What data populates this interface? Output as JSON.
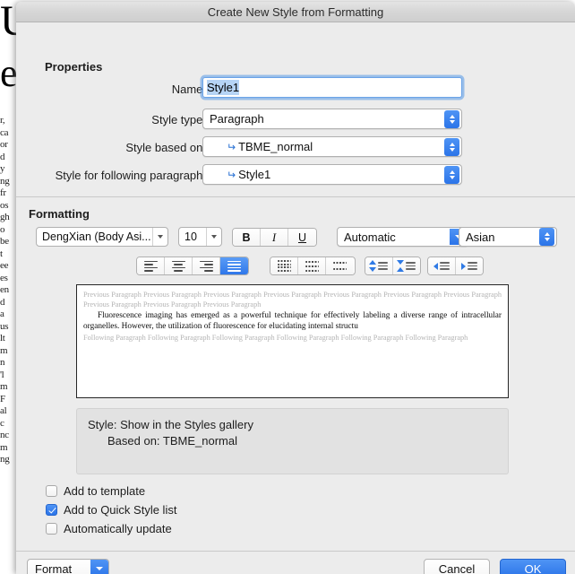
{
  "background_document": {
    "fragment_lines": [
      "r,",
      "ca",
      "or",
      "d",
      "y",
      "ng",
      "fr",
      "os",
      "gh",
      "o",
      "be",
      "t",
      "ee",
      "es",
      "en",
      "d",
      "a",
      "us",
      "lt",
      "m",
      "n",
      "'l",
      "m",
      "F",
      "al",
      "c",
      "nc",
      "m",
      "ng"
    ]
  },
  "dialog": {
    "title": "Create New Style from Formatting",
    "properties": {
      "heading": "Properties",
      "name_label": "Name:",
      "name_value": "Style1",
      "style_type_label": "Style type:",
      "style_type_value": "Paragraph",
      "style_based_on_label": "Style based on:",
      "style_based_on_value": "TBME_normal",
      "style_following_label": "Style for following paragraph:",
      "style_following_value": "Style1",
      "pilcrow_glyph": "↵"
    },
    "formatting": {
      "heading": "Formatting",
      "font_family": "DengXian (Body Asi...",
      "font_size": "10",
      "bold_label": "B",
      "italic_label": "I",
      "underline_label": "U",
      "color_value": "Automatic",
      "script_value": "Asian",
      "align_buttons": [
        "align-left",
        "align-center",
        "align-right",
        "align-justify"
      ],
      "align_selected": 3,
      "linespacing_buttons": [
        "line-spacing-single",
        "line-spacing-1-5",
        "line-spacing-double"
      ],
      "linespacing_selected": 0,
      "paraspacing_buttons": [
        "decrease-paragraph-spacing",
        "increase-paragraph-spacing"
      ],
      "indent_buttons": [
        "decrease-indent",
        "increase-indent"
      ]
    },
    "preview": {
      "previous_paragraph": "Previous Paragraph Previous Paragraph Previous Paragraph Previous Paragraph Previous Paragraph Previous Paragraph Previous Paragraph Previous Paragraph Previous Paragraph Previous Paragraph",
      "sample_text": "Fluorescence imaging has emerged as a powerful technique for effectively labeling a diverse range of intracellular organelles. However, the utilization of fluorescence for elucidating internal structu",
      "following_paragraph": "Following Paragraph Following Paragraph Following Paragraph Following Paragraph Following Paragraph Following Paragraph"
    },
    "description": {
      "line1": "Style: Show in the Styles gallery",
      "line2": "Based on: TBME_normal"
    },
    "checkboxes": [
      {
        "label": "Add to template",
        "checked": false
      },
      {
        "label": "Add to Quick Style list",
        "checked": true
      },
      {
        "label": "Automatically update",
        "checked": false
      }
    ],
    "footer": {
      "format_label": "Format",
      "cancel_label": "Cancel",
      "ok_label": "OK"
    }
  },
  "colors": {
    "accent_blue": "#2b74e8",
    "dialog_bg": "#ececec",
    "description_bg": "#e2e2e2",
    "selection_blue": "#b6d4f5"
  }
}
